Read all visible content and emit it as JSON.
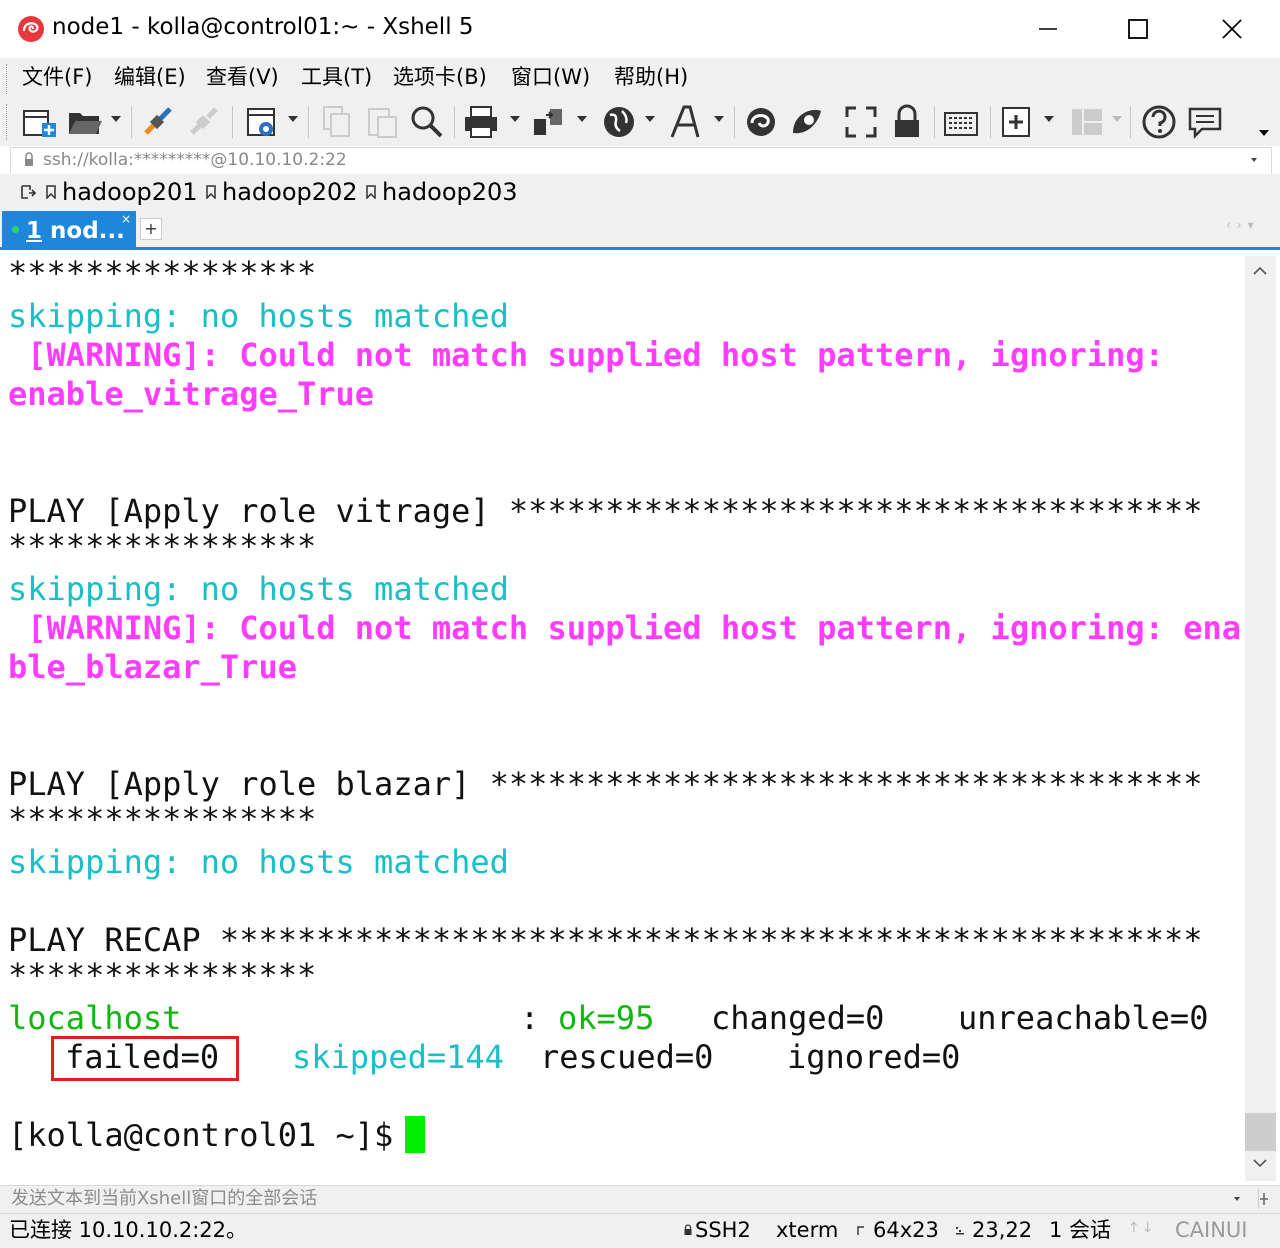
{
  "window": {
    "title": "node1 - kolla@control01:~ - Xshell 5",
    "controls": {
      "minimize": "minimize-icon",
      "maximize": "maximize-icon",
      "close": "close-icon"
    }
  },
  "menu": {
    "items": [
      "文件(F)",
      "编辑(E)",
      "查看(V)",
      "工具(T)",
      "选项卡(B)",
      "窗口(W)",
      "帮助(H)"
    ]
  },
  "toolbar": {
    "icons": [
      "new-session-icon",
      "open-icon",
      "reconnect-icon",
      "disconnect-icon",
      "properties-icon",
      "copy-icon",
      "paste-icon",
      "find-icon",
      "print-icon",
      "transfer-icon",
      "globe-icon",
      "font-icon",
      "xftp-icon",
      "xmanager-icon",
      "fullscreen-icon",
      "lock-icon",
      "keyboard-icon",
      "add-icon",
      "layout-icon",
      "help-icon",
      "chat-icon"
    ]
  },
  "address": {
    "value": "ssh://kolla:*********@10.10.10.2:22"
  },
  "links": {
    "items": [
      "hadoop201",
      "hadoop202",
      "hadoop203"
    ]
  },
  "tabs": {
    "active_label_number": "1",
    "active_label_text": " nod...",
    "close": "×",
    "add": "+"
  },
  "terminal": {
    "lines": [
      {
        "text": "****************",
        "color": "black"
      },
      {
        "text": "skipping: no hosts matched",
        "color": "cyan"
      },
      {
        "text": " [WARNING]: Could not match supplied host pattern, ignoring:",
        "color": "magenta"
      },
      {
        "text": "enable_vitrage_True",
        "color": "magenta"
      },
      {
        "text": "",
        "color": "black"
      },
      {
        "text": "",
        "color": "black"
      },
      {
        "text": "PLAY [Apply role vitrage] ************************************",
        "color": "black"
      },
      {
        "text": "****************",
        "color": "black"
      },
      {
        "text": "skipping: no hosts matched",
        "color": "cyan"
      },
      {
        "text": " [WARNING]: Could not match supplied host pattern, ignoring: ena",
        "color": "magenta"
      },
      {
        "text": "ble_blazar_True",
        "color": "magenta"
      },
      {
        "text": "",
        "color": "black"
      },
      {
        "text": "",
        "color": "black"
      },
      {
        "text": "PLAY [Apply role blazar] *************************************",
        "color": "black"
      },
      {
        "text": "****************",
        "color": "black"
      },
      {
        "text": "skipping: no hosts matched",
        "color": "cyan"
      },
      {
        "text": "",
        "color": "black"
      },
      {
        "text": "PLAY RECAP ***************************************************",
        "color": "black"
      },
      {
        "text": "****************",
        "color": "black"
      }
    ],
    "recap": {
      "host": "localhost",
      "colon": ": ",
      "ok": "ok=95",
      "changed": "changed=0",
      "unreachable": "unreachable=0",
      "failed": "failed=0",
      "skipped": "skipped=144",
      "rescued": "rescued=0",
      "ignored": "ignored=0"
    },
    "prompt": "[kolla@control01 ~]$ "
  },
  "compose": {
    "placeholder": "发送文本到当前Xshell窗口的全部会话"
  },
  "status": {
    "connection": "已连接 10.10.10.2:22。",
    "protocol": "SSH2",
    "terminal_type": "xterm",
    "size": "64x23",
    "cursor_pos": "23,22",
    "sessions": "1 会话",
    "caps": "CAINUI"
  },
  "colors": {
    "accent": "#1e87db",
    "cyan": "#16c0c6",
    "magenta": "#ff3cff",
    "green": "#11b611",
    "cursor": "#00ee00",
    "highlight": "#e0201b"
  }
}
